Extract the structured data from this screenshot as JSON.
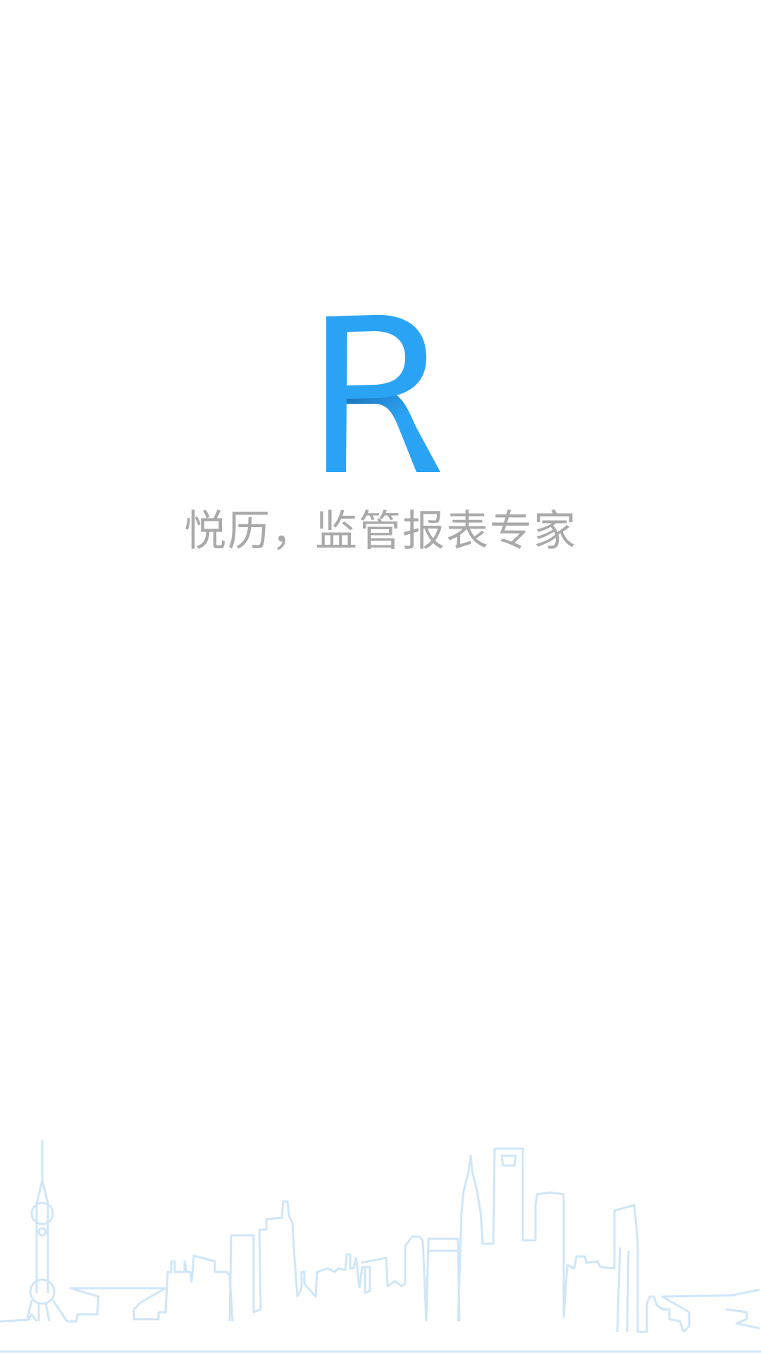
{
  "splash": {
    "slogan": "悦历，监管报表专家",
    "logo_icon": "letter-r-logo-icon",
    "skyline_icon": "city-skyline-outline-icon"
  },
  "colors": {
    "background": "#ffffff",
    "brand_blue": "#2aa3f5",
    "brand_blue_dark": "#1e6fb3",
    "slogan_gray": "#a9a9a9",
    "skyline_line": "#cfe6f8"
  }
}
